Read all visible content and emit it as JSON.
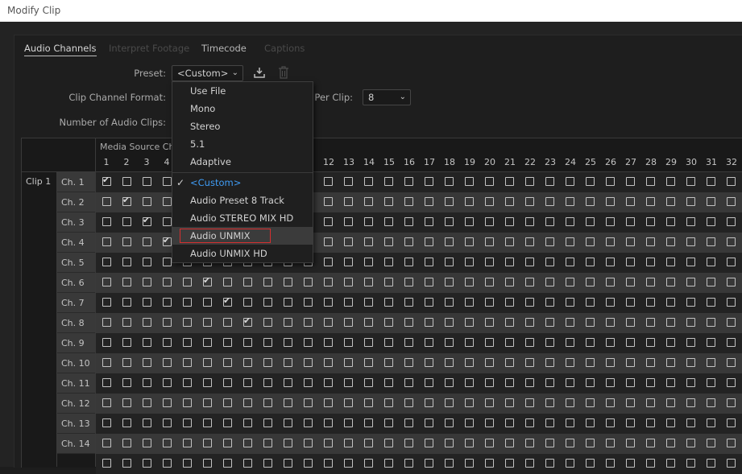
{
  "window": {
    "title": "Modify Clip"
  },
  "tabs": [
    {
      "label": "Audio Channels",
      "state": "active"
    },
    {
      "label": "Interpret Footage",
      "state": "disabled"
    },
    {
      "label": "Timecode",
      "state": "normal"
    },
    {
      "label": "Captions",
      "state": "disabled"
    }
  ],
  "form": {
    "preset_label": "Preset:",
    "preset_value": "<Custom>",
    "clip_channel_format_label": "Clip Channel Format:",
    "channels_per_clip_label": "s Per Clip:",
    "channels_per_clip_value": "8",
    "number_of_audio_clips_label": "Number of Audio Clips:"
  },
  "grid": {
    "header": "Media Source Cha",
    "column_numbers_left": [
      "1",
      "2",
      "3",
      "4"
    ],
    "column_numbers_right": [
      "12",
      "13",
      "14",
      "15",
      "16",
      "17",
      "18",
      "19",
      "20",
      "21",
      "22",
      "23",
      "24",
      "25",
      "26",
      "27",
      "28",
      "29",
      "30",
      "31",
      "32"
    ],
    "clip_label": "Clip 1",
    "rows": [
      "Ch. 1",
      "Ch. 2",
      "Ch. 3",
      "Ch. 4",
      "Ch. 5",
      "Ch. 6",
      "Ch. 7",
      "Ch. 8",
      "Ch. 9",
      "Ch. 10",
      "Ch. 11",
      "Ch. 12",
      "Ch. 13",
      "Ch. 14"
    ]
  },
  "preset_menu": {
    "items_top": [
      "Use File",
      "Mono",
      "Stereo",
      "5.1",
      "Adaptive"
    ],
    "items_bottom": [
      "<Custom>",
      "Audio Preset 8 Track",
      "Audio STEREO MIX HD FNL",
      "Audio UNMIX",
      "Audio UNMIX HD"
    ],
    "selected": "<Custom>",
    "highlighted": "Audio UNMIX"
  },
  "colors": {
    "accent": "#3f9cf5",
    "highlight_border": "#d62f2f"
  }
}
